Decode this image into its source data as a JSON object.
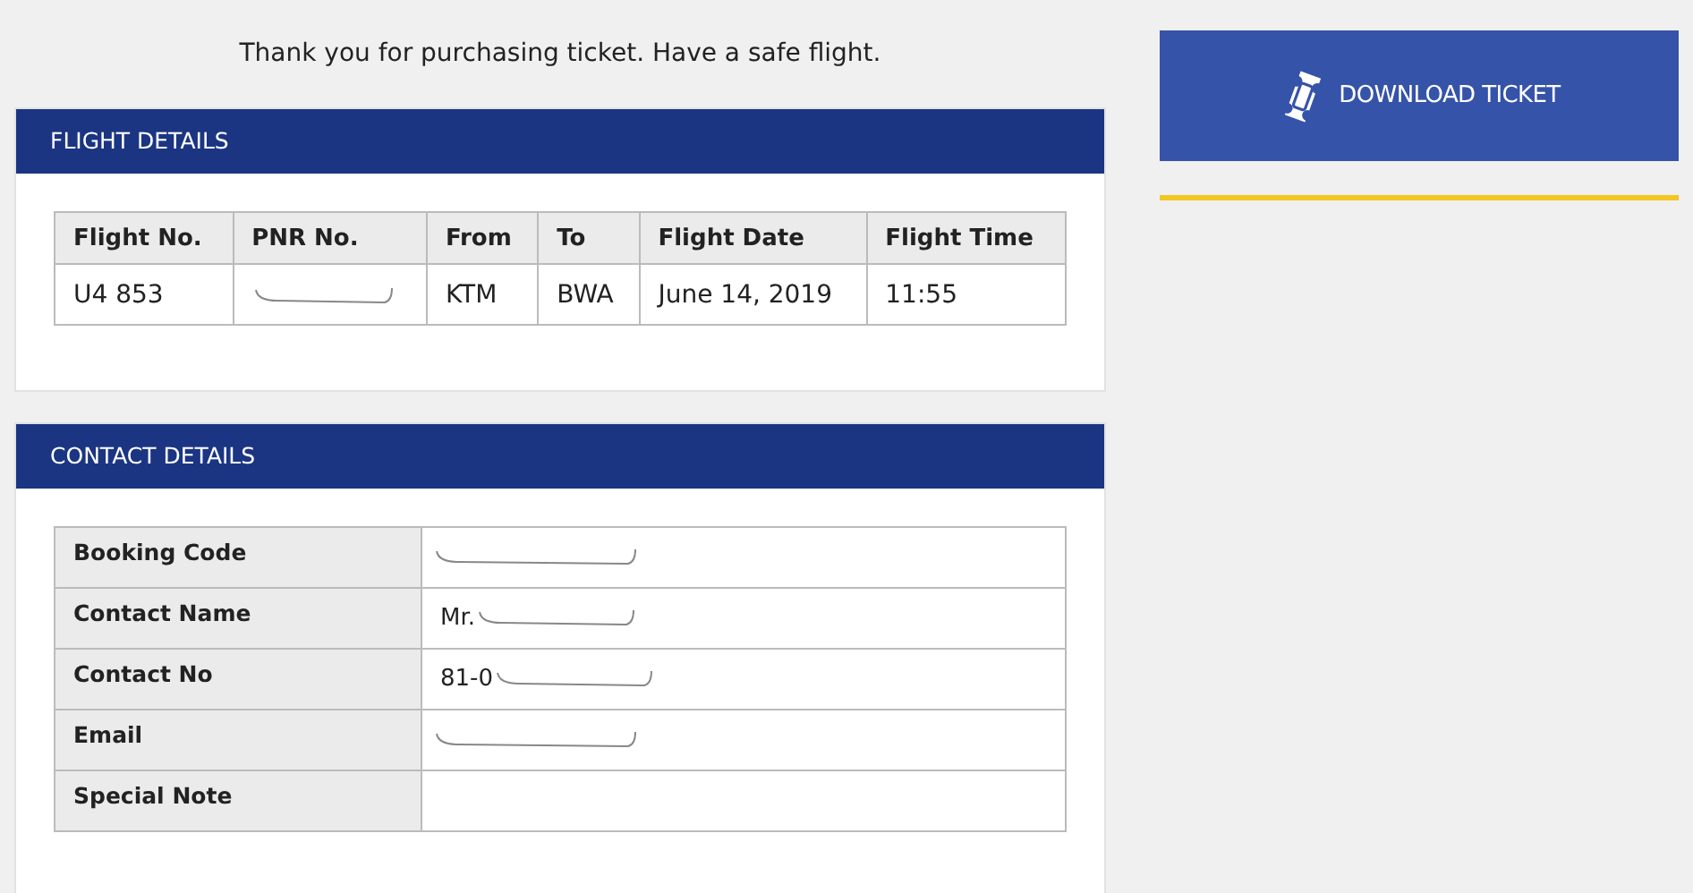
{
  "message": "Thank you for purchasing ticket. Have a safe flight.",
  "flight_details": {
    "title": "FLIGHT DETAILS",
    "columns": [
      "Flight No.",
      "PNR No.",
      "From",
      "To",
      "Flight Date",
      "Flight Time"
    ],
    "rows": [
      [
        {
          "text": "U4 853",
          "redacted": false
        },
        {
          "text": "",
          "redacted": true
        },
        {
          "text": "KTM",
          "redacted": false
        },
        {
          "text": "BWA",
          "redacted": false
        },
        {
          "text": "June 14, 2019",
          "redacted": false
        },
        {
          "text": "11:55",
          "redacted": false
        }
      ]
    ]
  },
  "contact_details": {
    "title": "CONTACT DETAILS",
    "rows": [
      {
        "label": "Booking Code",
        "value": "",
        "redacted": true
      },
      {
        "label": "Contact Name",
        "value": "Mr.",
        "redacted": true
      },
      {
        "label": "Contact No",
        "value": "81-0",
        "redacted": true
      },
      {
        "label": "Email",
        "value": "",
        "redacted": true
      },
      {
        "label": "Special Note",
        "value": "",
        "redacted": false
      }
    ]
  },
  "download_button": {
    "label": "DOWNLOAD TICKET"
  }
}
